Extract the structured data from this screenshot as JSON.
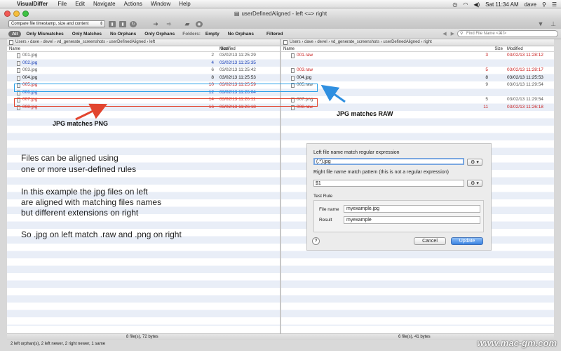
{
  "menubar": {
    "apple": "",
    "app_name": "VisualDiffer",
    "items": [
      "File",
      "Edit",
      "Navigate",
      "Actions",
      "Window",
      "Help"
    ],
    "clock": "Sat 11:34 AM",
    "user": "dave"
  },
  "window": {
    "title": "userDefinedAligned - left <=> right"
  },
  "toolbar": {
    "compare_combo": "Compare file timestamp, size and content"
  },
  "filters": {
    "items": [
      "All",
      "Only Mismatches",
      "Only Matches",
      "No Orphans",
      "Only Orphans"
    ],
    "folders_label": "Folders:",
    "folder_items": [
      "Empty",
      "No Orphans"
    ],
    "filtered": "Filtered"
  },
  "search": {
    "placeholder": "Find File Name <⌘f>"
  },
  "left": {
    "path": "Users  ›  dave  ›  devel  ›  vd_generate_screenshots  ›  userDefinedAligned  ›  left",
    "col_name": "Name",
    "col_size": "Size",
    "col_modified": "Modified",
    "rows": [
      {
        "name": "001.jpg",
        "size": "2",
        "date": "03/02/13 11:25:29",
        "color": "gray"
      },
      {
        "name": "002.jpg",
        "size": "4",
        "date": "03/02/13 11:25:35",
        "color": "blue"
      },
      {
        "name": "003.jpg",
        "size": "6",
        "date": "03/02/13 11:25:42",
        "color": "gray"
      },
      {
        "name": "004.jpg",
        "size": "8",
        "date": "03/02/13 11:25:53",
        "color": "black"
      },
      {
        "name": "005.jpg",
        "size": "10",
        "date": "03/02/13 11:25:59",
        "color": "red"
      },
      {
        "name": "006.jpg",
        "size": "12",
        "date": "03/02/13 11:26:04",
        "color": "blue"
      },
      {
        "name": "007.jpg",
        "size": "14",
        "date": "03/02/13 11:26:11",
        "color": "red"
      },
      {
        "name": "008.jpg",
        "size": "16",
        "date": "03/02/13 11:26:18",
        "color": "red"
      }
    ],
    "status": "8 file(s), 72 bytes"
  },
  "right": {
    "path": "Users  ›  dave  ›  devel  ›  vd_generate_screenshots  ›  userDefinedAligned  ›  right",
    "col_name": "Name",
    "col_size": "Size",
    "col_modified": "Modified",
    "rows": [
      {
        "name": "001.raw",
        "size": "3",
        "date": "03/02/13 11:28:12",
        "color": "red"
      },
      {
        "name": "",
        "size": "",
        "date": "",
        "color": "gray"
      },
      {
        "name": "003.raw",
        "size": "5",
        "date": "03/02/13 11:28:17",
        "color": "red"
      },
      {
        "name": "004.jpg",
        "size": "8",
        "date": "03/02/13 11:25:53",
        "color": "black"
      },
      {
        "name": "005.raw",
        "size": "9",
        "date": "03/01/13 11:29:54",
        "color": "gray"
      },
      {
        "name": "",
        "size": "",
        "date": "",
        "color": "gray"
      },
      {
        "name": "007.png",
        "size": "5",
        "date": "03/02/13 11:29:54",
        "color": "gray"
      },
      {
        "name": "008.raw",
        "size": "11",
        "date": "03/02/13 11:26:18",
        "color": "red"
      }
    ],
    "status": "6 file(s), 41 bytes"
  },
  "summary": "2 left orphan(s), 2 left newer, 2 right newer, 1 same",
  "annotations": {
    "png": "JPG matches PNG",
    "raw": "JPG matches RAW",
    "info": [
      "Files can be aligned using",
      "one or more user-defined rules",
      "",
      "In this example the jpg files on left",
      "are aligned with matching files names",
      "but different extensions on right",
      "",
      "So .jpg on left match .raw and .png on right"
    ]
  },
  "dialog": {
    "left_label": "Left file name match regular expression",
    "left_value": "(.*).jpg",
    "right_label": "Right file name match pattern (this is not a regular expression)",
    "right_value": "$1",
    "test_rule": "Test Rule",
    "file_name_label": "File name",
    "file_name_value": "myexample.jpg",
    "result_label": "Result",
    "result_value": "myexample",
    "help": "?",
    "cancel": "Cancel",
    "update": "Update",
    "gear": "⚙ ▾"
  },
  "watermark": "www.mac-gm.com",
  "colors": {
    "gray": "#555555",
    "blue": "#1a40b8",
    "red": "#c81e1e",
    "black": "#111111",
    "accent": "#3a83e2"
  }
}
